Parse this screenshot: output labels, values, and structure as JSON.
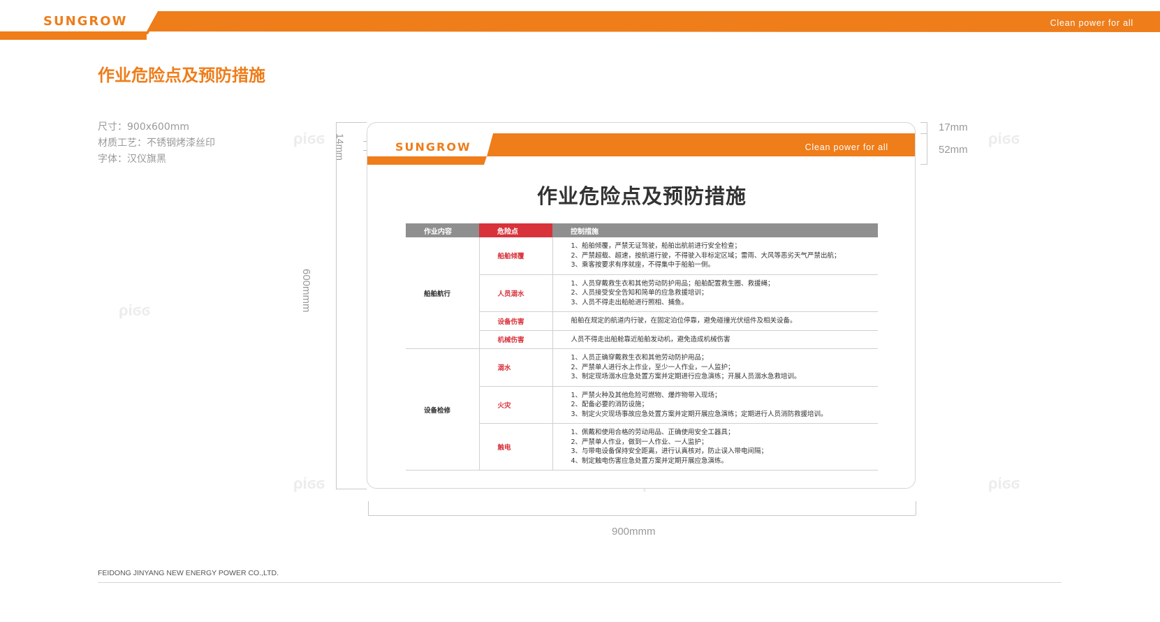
{
  "header": {
    "logo": "SUNGROW",
    "slogan": "Clean  power  for  all",
    "accent_color": "#ee7d1a"
  },
  "page_title": "作业危险点及预防措施",
  "specs": {
    "size": "尺寸：900x600mm",
    "material": "材质工艺：不锈钢烤漆丝印",
    "font": "字体：汉仪旗黑"
  },
  "dimensions": {
    "top_offset": "14mm",
    "band_top": "17mm",
    "band_height": "52mm",
    "height": "600mmm",
    "width": "900mmm"
  },
  "board": {
    "logo": "SUNGROW",
    "slogan": "Clean  power  for  all",
    "title": "作业危险点及预防措施",
    "table": {
      "headers": [
        "作业内容",
        "危险点",
        "控制措施"
      ],
      "header_colors": {
        "default": "#8f8f8f",
        "hazard": "#d8323b"
      },
      "groups": [
        {
          "category": "船舶航行",
          "rows": [
            {
              "hazard": "船舶倾覆",
              "measures": [
                "1、船舶倾覆，严禁无证驾驶，船舶出航前进行安全检查；",
                "2、严禁超载、超速，按航道行驶，不得驶入非标定区域；雷雨、大风等恶劣天气严禁出航；",
                "3、乘客按要求有序就座，不得集中于船舶一侧。"
              ]
            },
            {
              "hazard": "人员溺水",
              "measures": [
                "1、人员穿戴救生衣和其他劳动防护用品；船舶配置救生圈、救援绳；",
                "2、人员接受安全告知和简单的应急救援培训；",
                "3、人员不得走出船舱进行照相、捕鱼。"
              ]
            },
            {
              "hazard": "设备伤害",
              "measures": [
                "船舶在规定的航道内行驶，在固定泊位停靠，避免碰撞光伏组件及相关设备。"
              ]
            },
            {
              "hazard": "机械伤害",
              "measures": [
                "人员不得走出船舱靠近船舶发动机，避免造成机械伤害"
              ]
            }
          ]
        },
        {
          "category": "设备检修",
          "rows": [
            {
              "hazard": "溺水",
              "measures": [
                "1、人员正确穿戴救生衣和其他劳动防护用品；",
                "2、严禁单人进行水上作业，至少一人作业，一人监护；",
                "3、制定现场溺水应急处置方案并定期进行应急演练；开展人员溺水急救培训。"
              ]
            },
            {
              "hazard": "火灾",
              "measures": [
                "1、严禁火种及其他危险可燃物、爆炸物带入现场；",
                "2、配备必要的消防设施；",
                "3、制定火灾现场事故应急处置方案并定期开展应急演练；定期进行人员消防救援培训。"
              ]
            },
            {
              "hazard": "触电",
              "measures": [
                "1、佩戴和使用合格的劳动用品、正确使用安全工器具；",
                "2、严禁单人作业，做到一人作业、一人监护；",
                "3、与带电设备保持安全距离，进行认真核对，防止误入带电间隔；",
                "4、制定触电伤害应急处置方案并定期开展应急演练。"
              ]
            }
          ]
        }
      ]
    }
  },
  "footer": {
    "company": "FEIDONG JINYANG NEW ENERGY POWER CO.,LTD."
  }
}
